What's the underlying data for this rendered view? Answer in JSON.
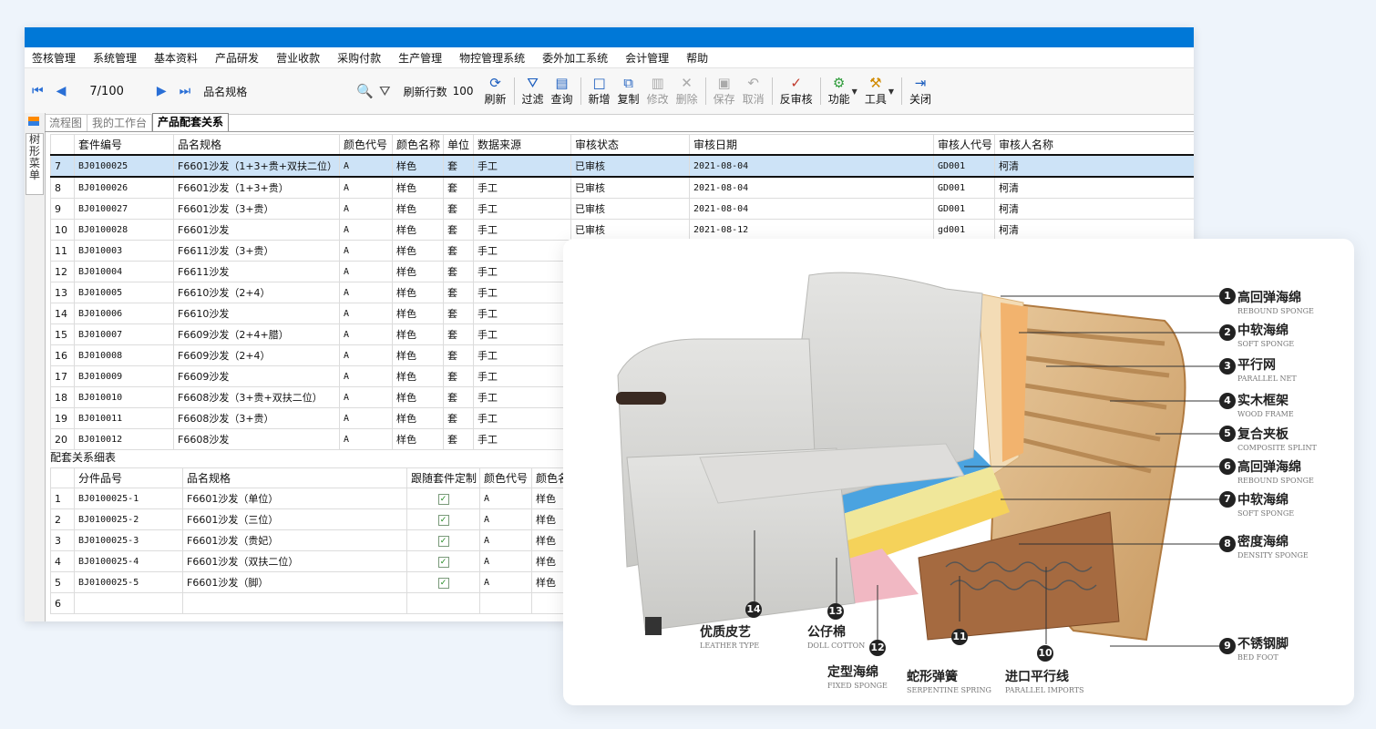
{
  "menu": [
    "签核管理",
    "系统管理",
    "基本资料",
    "产品研发",
    "营业收款",
    "采购付款",
    "生产管理",
    "物控管理系统",
    "委外加工系统",
    "会计管理",
    "帮助"
  ],
  "toolbar": {
    "record": "7/100",
    "spec_label": "品名规格",
    "rows_label": "刷新行数",
    "rows_value": "100",
    "buttons": {
      "refresh": "刷新",
      "filter": "过滤",
      "query": "查询",
      "add": "新增",
      "copy": "复制",
      "edit": "修改",
      "delete": "删除",
      "save": "保存",
      "cancel": "取消",
      "unapprove": "反审核",
      "function": "功能",
      "tools": "工具",
      "close": "关闭"
    }
  },
  "sidebar": {
    "tree_menu": "树形菜单"
  },
  "tabs": [
    "流程图",
    "我的工作台",
    "产品配套关系"
  ],
  "main_table": {
    "headers": [
      "",
      "套件编号",
      "品名规格",
      "颜色代号",
      "颜色名称",
      "单位",
      "数据来源",
      "审核状态",
      "审核日期",
      "审核人代号",
      "审核人名称"
    ],
    "rows": [
      [
        "7",
        "BJ0100025",
        "F6601沙发（1+3+贵+双扶二位）",
        "A",
        "样色",
        "套",
        "手工",
        "已审核",
        "2021-08-04",
        "GD001",
        "柯清"
      ],
      [
        "8",
        "BJ0100026",
        "F6601沙发（1+3+贵）",
        "A",
        "样色",
        "套",
        "手工",
        "已审核",
        "2021-08-04",
        "GD001",
        "柯清"
      ],
      [
        "9",
        "BJ0100027",
        "F6601沙发（3+贵）",
        "A",
        "样色",
        "套",
        "手工",
        "已审核",
        "2021-08-04",
        "GD001",
        "柯清"
      ],
      [
        "10",
        "BJ0100028",
        "F6601沙发",
        "A",
        "样色",
        "套",
        "手工",
        "已审核",
        "2021-08-12",
        "gd001",
        "柯清"
      ],
      [
        "11",
        "BJ010003",
        "F6611沙发（3+贵）",
        "A",
        "样色",
        "套",
        "手工",
        "",
        "",
        "",
        ""
      ],
      [
        "12",
        "BJ010004",
        "F6611沙发",
        "A",
        "样色",
        "套",
        "手工",
        "",
        "",
        "",
        ""
      ],
      [
        "13",
        "BJ010005",
        "F6610沙发（2+4）",
        "A",
        "样色",
        "套",
        "手工",
        "",
        "",
        "",
        ""
      ],
      [
        "14",
        "BJ010006",
        "F6610沙发",
        "A",
        "样色",
        "套",
        "手工",
        "",
        "",
        "",
        ""
      ],
      [
        "15",
        "BJ010007",
        "F6609沙发（2+4+腊）",
        "A",
        "样色",
        "套",
        "手工",
        "",
        "",
        "",
        ""
      ],
      [
        "16",
        "BJ010008",
        "F6609沙发（2+4）",
        "A",
        "样色",
        "套",
        "手工",
        "",
        "",
        "",
        ""
      ],
      [
        "17",
        "BJ010009",
        "F6609沙发",
        "A",
        "样色",
        "套",
        "手工",
        "",
        "",
        "",
        ""
      ],
      [
        "18",
        "BJ010010",
        "F6608沙发（3+贵+双扶二位）",
        "A",
        "样色",
        "套",
        "手工",
        "",
        "",
        "",
        ""
      ],
      [
        "19",
        "BJ010011",
        "F6608沙发（3+贵）",
        "A",
        "样色",
        "套",
        "手工",
        "",
        "",
        "",
        ""
      ],
      [
        "20",
        "BJ010012",
        "F6608沙发",
        "A",
        "样色",
        "套",
        "手工",
        "",
        "",
        "",
        ""
      ]
    ]
  },
  "sub_title": "配套关系细表",
  "sub_table": {
    "headers": [
      "",
      "分件品号",
      "品名规格",
      "跟随套件定制",
      "颜色代号",
      "颜色名"
    ],
    "rows": [
      [
        "1",
        "BJ0100025-1",
        "F6601沙发（单位）",
        "✓",
        "A",
        "样色"
      ],
      [
        "2",
        "BJ0100025-2",
        "F6601沙发（三位）",
        "✓",
        "A",
        "样色"
      ],
      [
        "3",
        "BJ0100025-3",
        "F6601沙发（贵妃）",
        "✓",
        "A",
        "样色"
      ],
      [
        "4",
        "BJ0100025-4",
        "F6601沙发（双扶二位）",
        "✓",
        "A",
        "样色"
      ],
      [
        "5",
        "BJ0100025-5",
        "F6601沙发（脚）",
        "✓",
        "A",
        "样色"
      ],
      [
        "6",
        "",
        "",
        "",
        "",
        ""
      ]
    ]
  },
  "sofa_labels": [
    {
      "n": "1",
      "zh": "高回弹海绵",
      "en": "REBOUND SPONGE"
    },
    {
      "n": "2",
      "zh": "中软海绵",
      "en": "SOFT SPONGE"
    },
    {
      "n": "3",
      "zh": "平行网",
      "en": "PARALLEL NET"
    },
    {
      "n": "4",
      "zh": "实木框架",
      "en": "WOOD FRAME"
    },
    {
      "n": "5",
      "zh": "复合夹板",
      "en": "COMPOSITE SPLINT"
    },
    {
      "n": "6",
      "zh": "高回弹海绵",
      "en": "REBOUND SPONGE"
    },
    {
      "n": "7",
      "zh": "中软海绵",
      "en": "SOFT SPONGE"
    },
    {
      "n": "8",
      "zh": "密度海绵",
      "en": "DENSITY SPONGE"
    },
    {
      "n": "9",
      "zh": "不锈钢脚",
      "en": "BED FOOT"
    },
    {
      "n": "10",
      "zh": "进口平行线",
      "en": "PARALLEL IMPORTS"
    },
    {
      "n": "11",
      "zh": "蛇形弹簧",
      "en": "SERPENTINE SPRING"
    },
    {
      "n": "12",
      "zh": "定型海绵",
      "en": "FIXED SPONGE"
    },
    {
      "n": "13",
      "zh": "公仔棉",
      "en": "DOLL COTTON"
    },
    {
      "n": "14",
      "zh": "优质皮艺",
      "en": "LEATHER TYPE"
    }
  ]
}
